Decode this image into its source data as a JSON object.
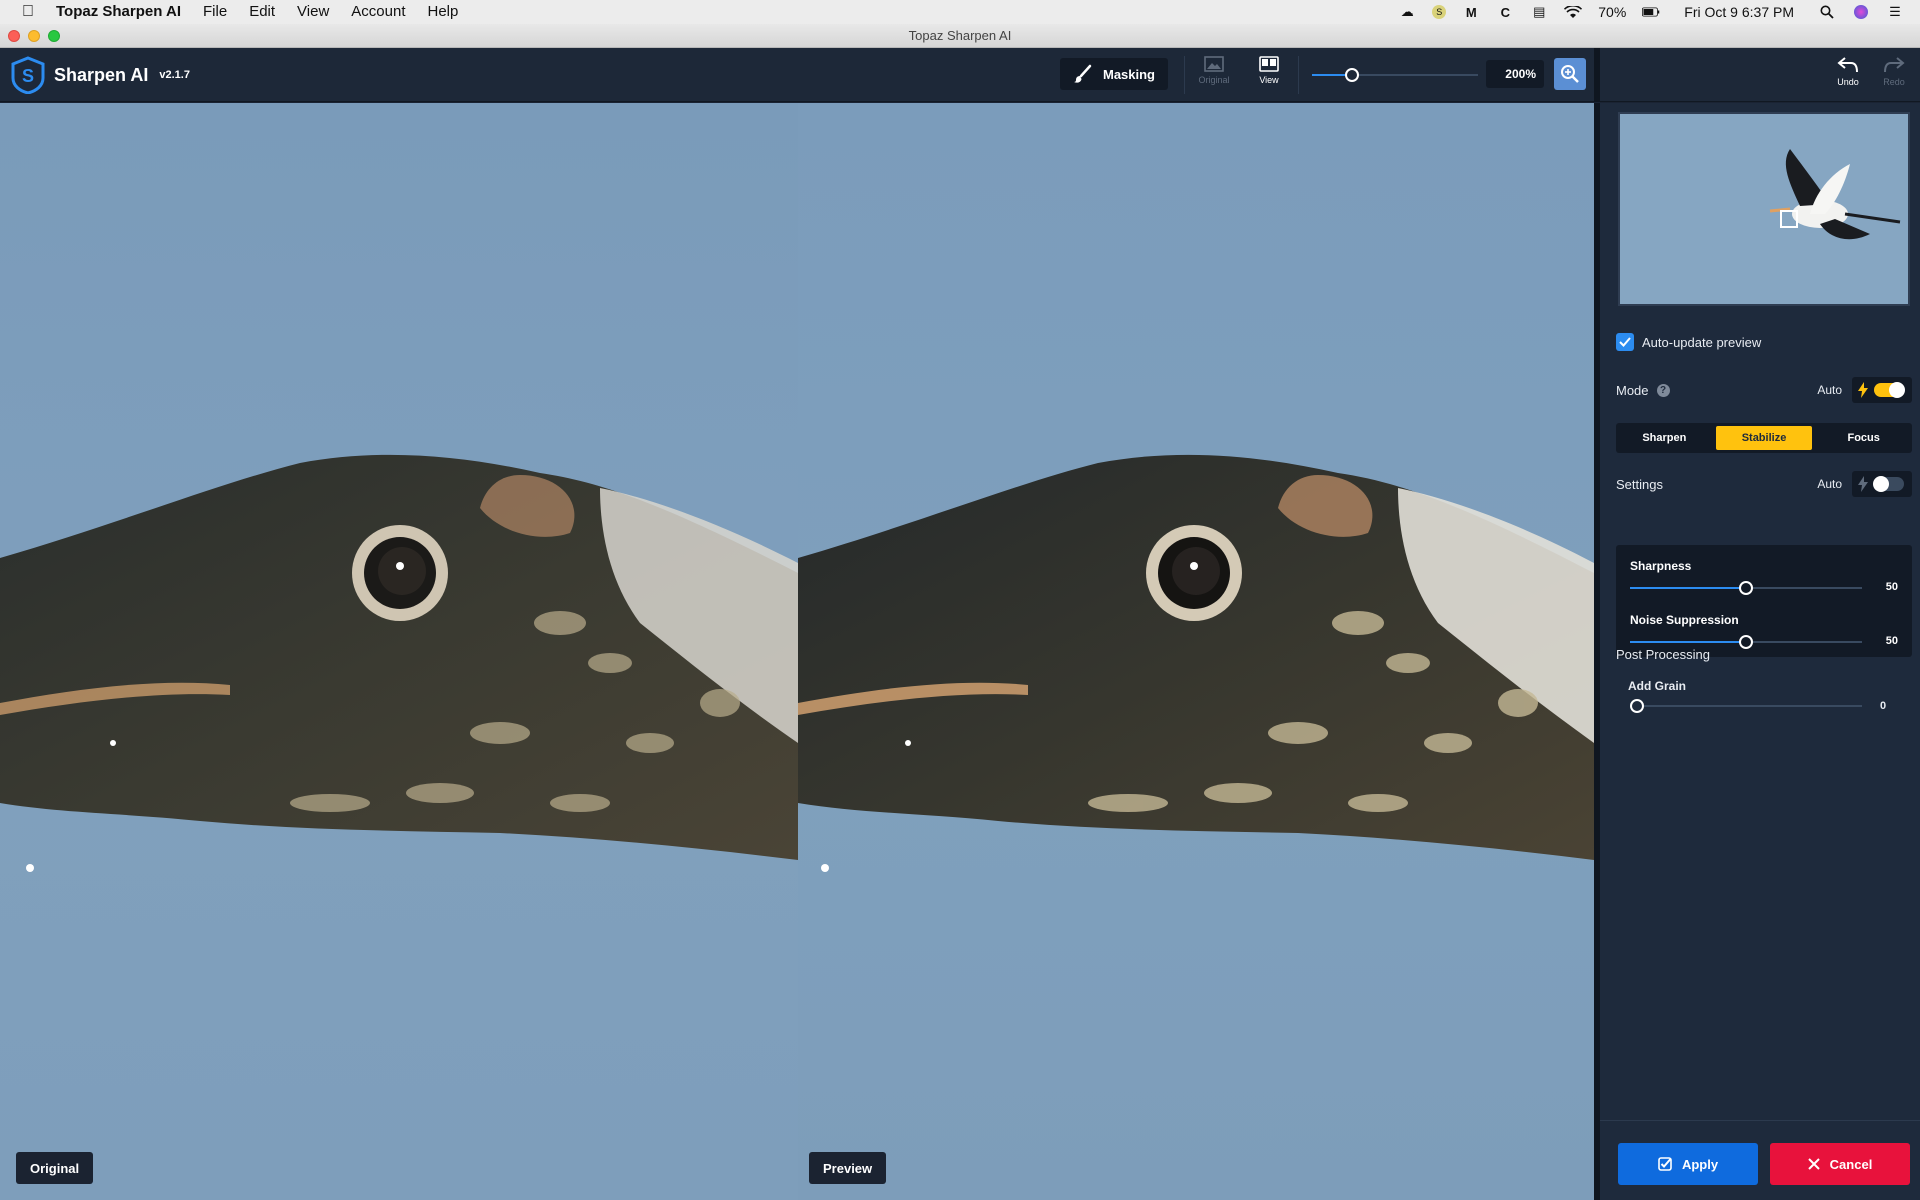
{
  "menubar": {
    "app_name": "Topaz Sharpen AI",
    "items": [
      "File",
      "Edit",
      "View",
      "Account",
      "Help"
    ],
    "battery": "70%",
    "clock": "Fri Oct 9  6:37 PM"
  },
  "window": {
    "title": "Topaz Sharpen AI"
  },
  "toolbar": {
    "brand": "Sharpen AI",
    "version": "v2.1.7",
    "masking_label": "Masking",
    "original_label": "Original",
    "view_label": "View",
    "zoom_value": "200%",
    "undo_label": "Undo",
    "redo_label": "Redo"
  },
  "canvas": {
    "original_label": "Original",
    "preview_label": "Preview"
  },
  "panel": {
    "auto_update_label": "Auto-update preview",
    "auto_update_checked": true,
    "mode_label": "Mode",
    "mode_auto_label": "Auto",
    "mode_auto_on": true,
    "modes": [
      "Sharpen",
      "Stabilize",
      "Focus"
    ],
    "active_mode": "Stabilize",
    "settings_label": "Settings",
    "settings_auto_label": "Auto",
    "settings_auto_on": false,
    "sharpness_label": "Sharpness",
    "sharpness_value": "50",
    "noise_label": "Noise Suppression",
    "noise_value": "50",
    "post_processing_label": "Post Processing",
    "grain_label": "Add Grain",
    "grain_value": "0",
    "apply_label": "Apply",
    "cancel_label": "Cancel"
  },
  "colors": {
    "accent": "#2c8cf0",
    "stabilize": "#ffc20e",
    "apply": "#0f6bde",
    "cancel": "#e8123c"
  }
}
